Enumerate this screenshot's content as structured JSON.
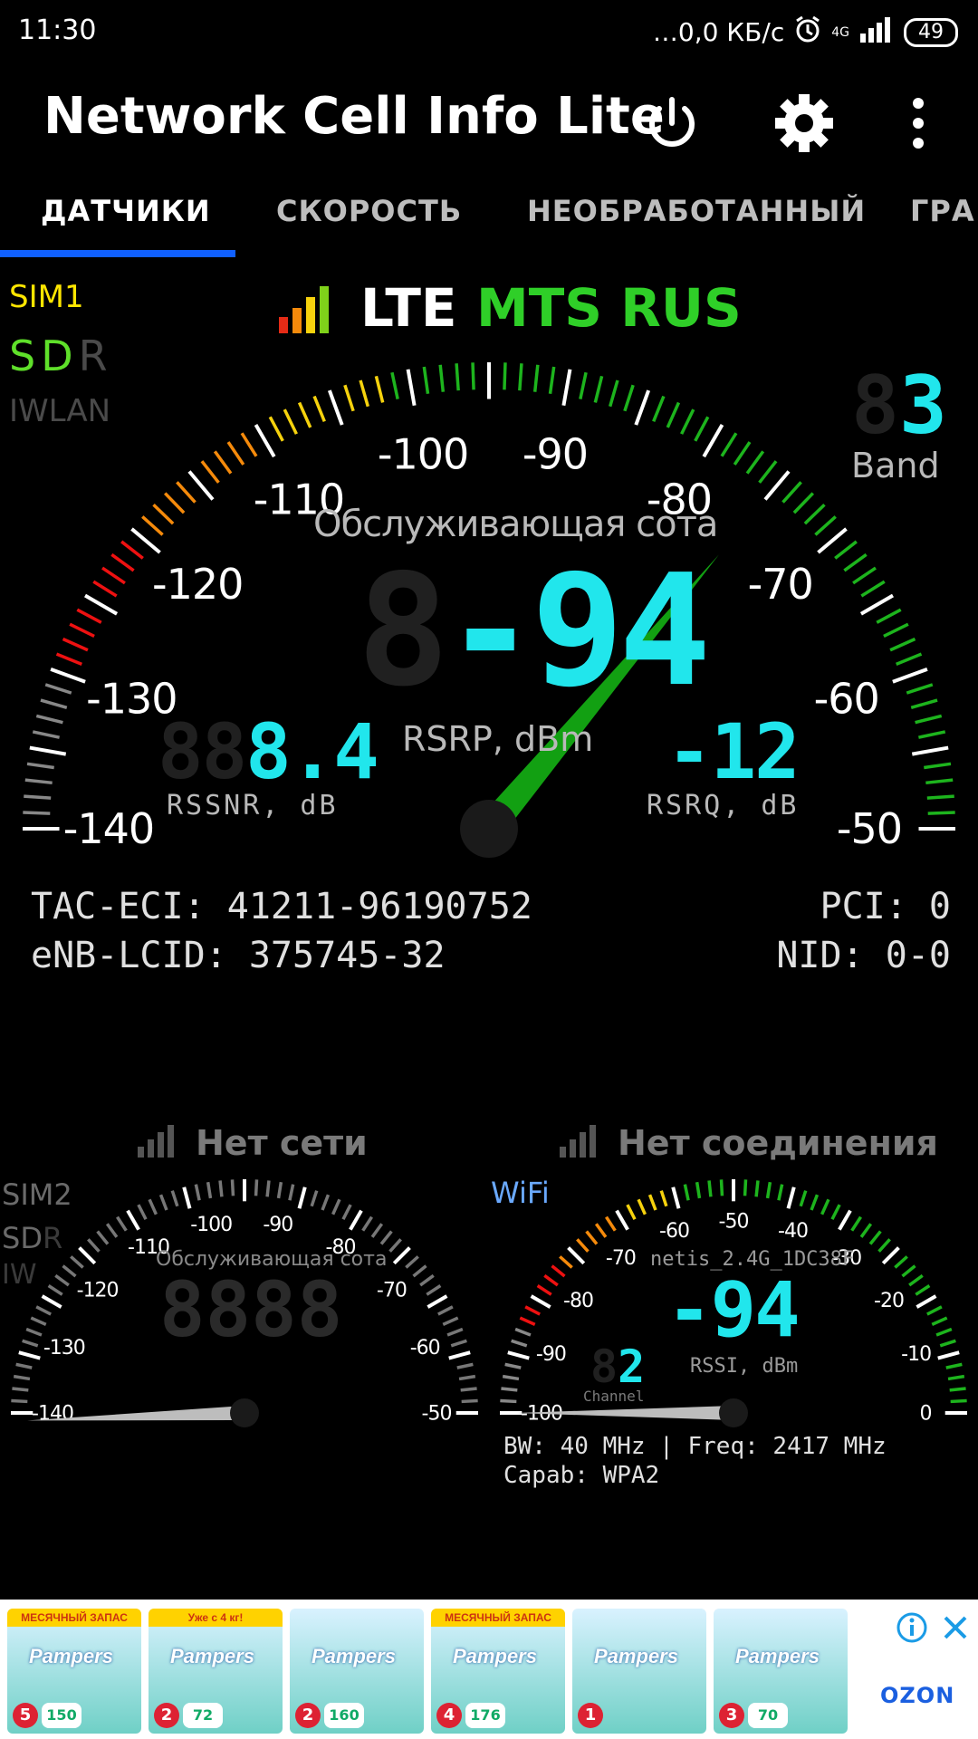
{
  "status_bar": {
    "time": "11:30",
    "speed": "…0,0 КБ/с",
    "network": "4G",
    "battery": "49"
  },
  "app_bar": {
    "title": "Network Cell Info Lite",
    "icons": [
      "power-icon",
      "gear-icon",
      "more-vert-icon"
    ]
  },
  "tabs": [
    {
      "label": "ДАТЧИКИ",
      "active": true
    },
    {
      "label": "СКОРОСТЬ",
      "active": false
    },
    {
      "label": "НЕОБРАБОТАННЫЙ",
      "active": false
    },
    {
      "label": "ГРА",
      "active": false
    }
  ],
  "sim1": {
    "sim_label": "SIM1",
    "sdr_s": "S",
    "sdr_d": "D",
    "sdr_r": "R",
    "iwlan": "IWLAN",
    "tech": "LTE",
    "operator": "MTS RUS",
    "band_value": "3",
    "band_label": "Band",
    "cell_label": "Обслуживающая сота",
    "rsrp_value": "-94",
    "rsrp_label": "RSRP, dBm",
    "rssnr_value": "8.4",
    "rssnr_label": "RSSNR, dB",
    "rsrq_value": "-12",
    "rsrq_label": "RSRQ, dB",
    "scale_labels": [
      "-140",
      "-130",
      "-120",
      "-110",
      "-100",
      "-90",
      "-80",
      "-70",
      "-60",
      "-50"
    ],
    "tac_eci": "TAC-ECI: 41211-96190752",
    "enb_lcid": "eNB-LCID: 375745-32",
    "pci": "PCI: 0",
    "nid": "NID: 0-0"
  },
  "sim2": {
    "title": "Нет сети",
    "sim_label": "SIM2",
    "sdr_s": "S",
    "sdr_d": "D",
    "sdr_r": "R",
    "iw": "IW",
    "cell_label": "Обслуживающая сота",
    "scale_labels": [
      "-140",
      "-130",
      "-120",
      "-110",
      "-100",
      "-90",
      "-80",
      "-70",
      "-60",
      "-50"
    ]
  },
  "wifi": {
    "title": "Нет соединения",
    "label": "WiFi",
    "ssid": "netis_2.4G_1DC38F",
    "rssi_value": "-94",
    "rssi_label": "RSSI, dBm",
    "channel_value": "2",
    "channel_label": "Channel",
    "scale_labels": [
      "-100",
      "-90",
      "-80",
      "-70",
      "-60",
      "-50",
      "-40",
      "-30",
      "-20",
      "-10",
      "0"
    ],
    "bw_freq": "BW: 40 MHz | Freq: 2417 MHz",
    "capab": "Capab: WPA2"
  },
  "gauge_values": {
    "sim1_needle_dbm": -75,
    "sim2_needle_dbm": -141,
    "wifi_needle_dbm": -100
  },
  "ad": {
    "badges": [
      "МЕСЯЧНЫЙ ЗАПАС",
      "Уже с 4 кг!",
      "",
      "МЕСЯЧНЫЙ ЗАПАС",
      "",
      ""
    ],
    "brand": "Pampers",
    "sizes": [
      "5",
      "2",
      "2",
      "4",
      "1",
      "3"
    ],
    "counts": [
      "150",
      "72",
      "160",
      "176",
      "",
      "70"
    ],
    "store": "OZON"
  },
  "colors": {
    "accent_blue": "#1060ff",
    "operator_green": "#2fcf28",
    "sdr_green": "#5fe02a",
    "sim_yellow": "#ffe600",
    "seven_seg_cyan": "#21e6ec",
    "needle_green": "#12a012"
  }
}
